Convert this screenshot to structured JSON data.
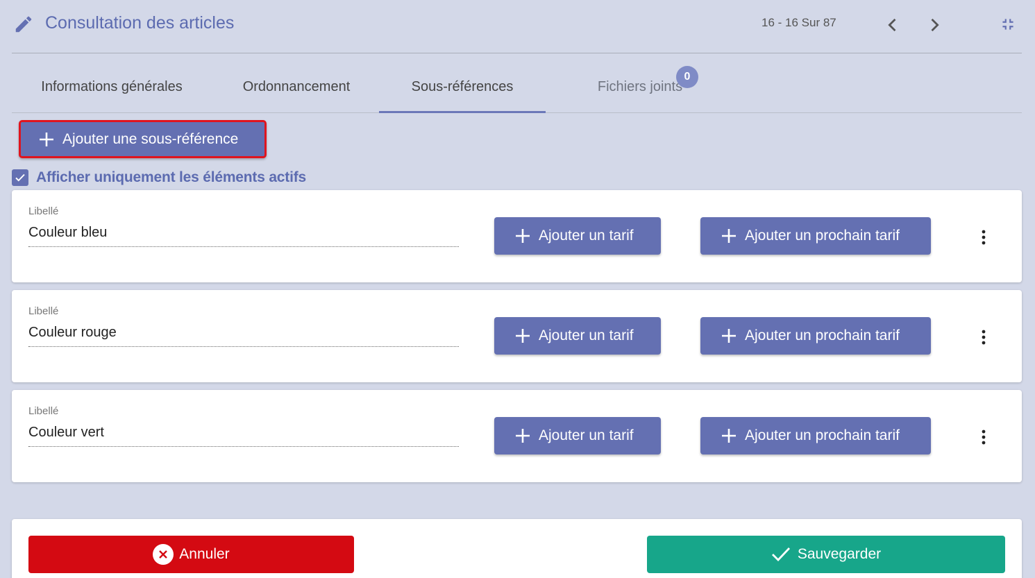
{
  "header": {
    "title": "Consultation des articles",
    "pager": "16 - 16 Sur 87",
    "icons": {
      "edit": "pencil-icon",
      "prev": "chevron-left-icon",
      "next": "chevron-right-icon",
      "collapse": "collapse-icon"
    }
  },
  "tabs": [
    {
      "label": "Informations générales"
    },
    {
      "label": "Ordonnancement"
    },
    {
      "label": "Sous-références",
      "active": true
    },
    {
      "label": "Fichiers joints",
      "badge": "0"
    }
  ],
  "toolbar": {
    "add_sub_label": "Ajouter une sous-référence"
  },
  "filter": {
    "label": "Afficher uniquement les éléments actifs",
    "checked": true
  },
  "items": [
    {
      "field_label": "Libellé",
      "value": "Couleur bleu",
      "tarif_label": "Ajouter un tarif",
      "prochain_label": "Ajouter un prochain tarif"
    },
    {
      "field_label": "Libellé",
      "value": "Couleur rouge",
      "tarif_label": "Ajouter un tarif",
      "prochain_label": "Ajouter un prochain tarif"
    },
    {
      "field_label": "Libellé",
      "value": "Couleur vert",
      "tarif_label": "Ajouter un tarif",
      "prochain_label": "Ajouter un prochain tarif"
    }
  ],
  "footer": {
    "cancel_label": "Annuler",
    "save_label": "Sauvegarder"
  },
  "colors": {
    "primary": "#6470b2",
    "danger": "#d40a12",
    "success": "#17a68a",
    "background": "#d3d8e8"
  }
}
